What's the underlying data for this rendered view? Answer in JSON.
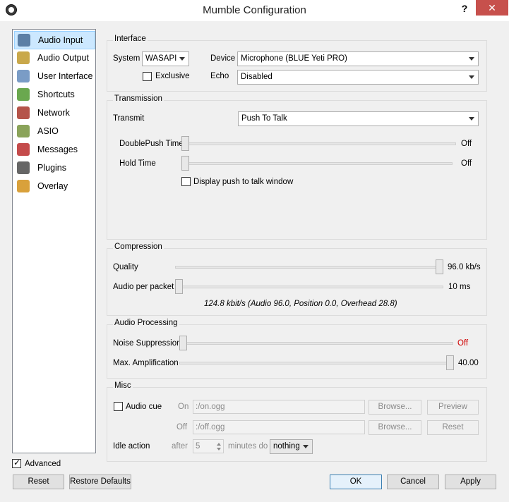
{
  "window": {
    "title": "Mumble Configuration",
    "help": "?",
    "close": "✕"
  },
  "sidebar": {
    "items": [
      {
        "label": "Audio Input",
        "icon": "microphone-icon",
        "color": "#5b7fa6"
      },
      {
        "label": "Audio Output",
        "icon": "speaker-icon",
        "color": "#c9a84b"
      },
      {
        "label": "User Interface",
        "icon": "window-icon",
        "color": "#7a9cc6"
      },
      {
        "label": "Shortcuts",
        "icon": "keyboard-icon",
        "color": "#6aa84f"
      },
      {
        "label": "Network",
        "icon": "network-icon",
        "color": "#b5544a"
      },
      {
        "label": "ASIO",
        "icon": "asio-icon",
        "color": "#8aa35a"
      },
      {
        "label": "Messages",
        "icon": "messages-icon",
        "color": "#c44b4b"
      },
      {
        "label": "Plugins",
        "icon": "plugin-icon",
        "color": "#666666"
      },
      {
        "label": "Overlay",
        "icon": "overlay-icon",
        "color": "#d9a13b"
      }
    ]
  },
  "interface": {
    "title": "Interface",
    "system_label": "System",
    "system_value": "WASAPI",
    "device_label": "Device",
    "device_value": "Microphone (BLUE Yeti PRO)",
    "exclusive_label": "Exclusive",
    "echo_label": "Echo",
    "echo_value": "Disabled"
  },
  "transmission": {
    "title": "Transmission",
    "transmit_label": "Transmit",
    "transmit_value": "Push To Talk",
    "doublepush_label": "DoublePush Time",
    "doublepush_value": "Off",
    "hold_label": "Hold Time",
    "hold_value": "Off",
    "ptt_window_label": "Display push to talk window"
  },
  "compression": {
    "title": "Compression",
    "quality_label": "Quality",
    "quality_value": "96.0 kb/s",
    "app_label": "Audio per packet",
    "app_value": "10 ms",
    "summary": "124.8 kbit/s (Audio 96.0, Position 0.0, Overhead 28.8)"
  },
  "processing": {
    "title": "Audio Processing",
    "noise_label": "Noise Suppression",
    "noise_value": "Off",
    "noise_color": "#d00000",
    "amp_label": "Max. Amplification",
    "amp_value": "40.00"
  },
  "misc": {
    "title": "Misc",
    "audio_cue_label": "Audio cue",
    "on_label": "On",
    "on_file": ":/on.ogg",
    "off_label": "Off",
    "off_file": ":/off.ogg",
    "browse_label": "Browse...",
    "preview_label": "Preview",
    "reset_label": "Reset",
    "idle_label": "Idle action",
    "after_label": "after",
    "after_value": "5",
    "minutes_label": "minutes do",
    "idle_value": "nothing"
  },
  "footer": {
    "advanced_label": "Advanced",
    "reset_label": "Reset",
    "restore_label": "Restore Defaults",
    "ok_label": "OK",
    "cancel_label": "Cancel",
    "apply_label": "Apply"
  }
}
